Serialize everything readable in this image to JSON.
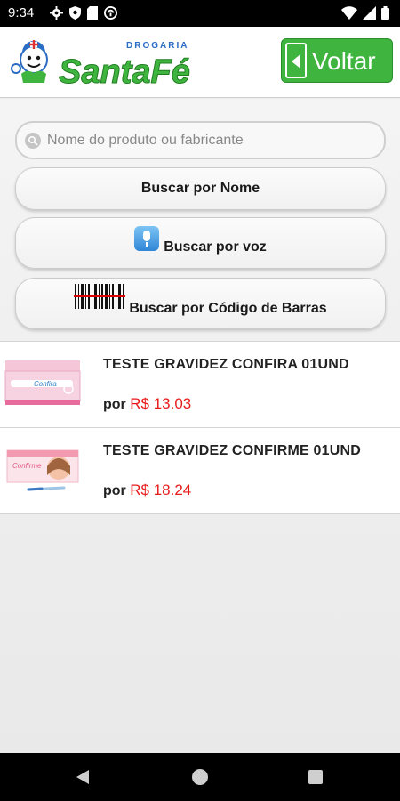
{
  "status_bar": {
    "time": "9:34",
    "left_icons": [
      "settings-icon",
      "shield-icon",
      "sd-card-icon",
      "sync-icon"
    ],
    "right_icons": [
      "wifi-icon",
      "signal-icon",
      "battery-icon"
    ]
  },
  "header": {
    "logo_small": "DROGARIA",
    "logo_main": "SantaFé",
    "back_label": "Voltar"
  },
  "search": {
    "placeholder": "Nome do produto ou fabricante",
    "value": ""
  },
  "buttons": {
    "by_name": "Buscar por Nome",
    "by_voice": "Buscar por voz",
    "by_barcode": "Buscar por Código de Barras"
  },
  "products": [
    {
      "name": "TESTE GRAVIDEZ CONFIRA 01UND",
      "price_prefix": "por",
      "price": "R$ 13.03",
      "thumb_text": "Confira"
    },
    {
      "name": "TESTE GRAVIDEZ CONFIRME 01UND",
      "price_prefix": "por",
      "price": "R$ 18.24",
      "thumb_text": "Confirme"
    }
  ],
  "colors": {
    "brand_green": "#3fb43f",
    "brand_blue": "#2b6cc4",
    "price_red": "#e81b1b"
  }
}
